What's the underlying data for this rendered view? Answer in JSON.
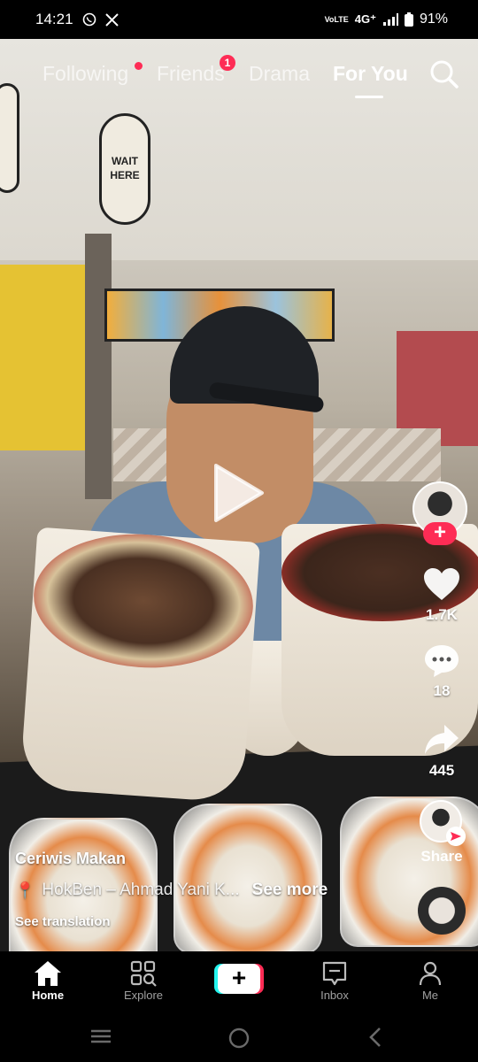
{
  "status_bar": {
    "time": "14:21",
    "left_icons": [
      "whatsapp-icon",
      "x-icon"
    ],
    "network_label": "4G⁺",
    "volte_label": "VoLTE",
    "battery": "91%"
  },
  "top_tabs": {
    "items": [
      {
        "label": "Following",
        "active": false,
        "dot": true
      },
      {
        "label": "Friends",
        "active": false,
        "badge": "1"
      },
      {
        "label": "Drama",
        "active": false
      },
      {
        "label": "For You",
        "active": true
      }
    ],
    "search_icon": "search-icon"
  },
  "video": {
    "sign_text": "WAIT HERE",
    "paused": true
  },
  "rail": {
    "like_count": "1.7K",
    "comment_count": "18",
    "share_count": "445",
    "share_label": "Share"
  },
  "caption": {
    "author": "Ceriwis Makan",
    "location": "HokBen – Ahmad Yani K...",
    "see_more": "See more",
    "translation": "See translation"
  },
  "bottom_nav": {
    "items": [
      {
        "label": "Home",
        "active": true
      },
      {
        "label": "Explore",
        "active": false
      },
      {
        "label": "",
        "create": true
      },
      {
        "label": "Inbox",
        "active": false
      },
      {
        "label": "Me",
        "active": false
      }
    ]
  },
  "colors": {
    "accent": "#fe2c55",
    "cyan": "#25f4ee",
    "background": "#000000"
  }
}
